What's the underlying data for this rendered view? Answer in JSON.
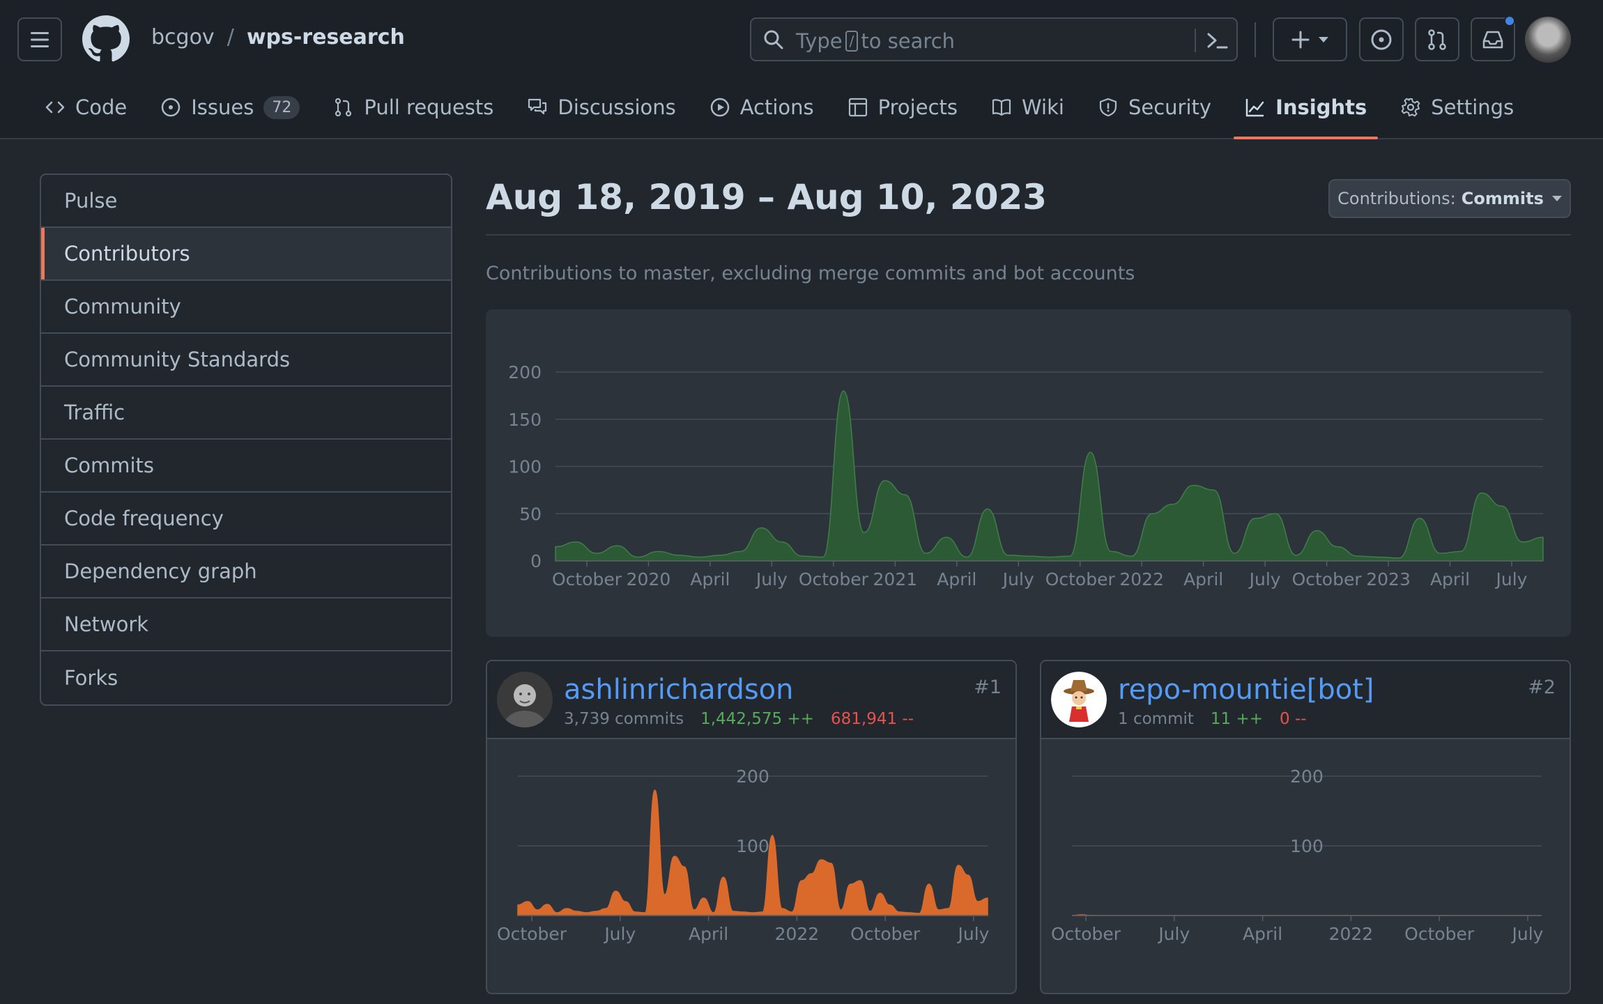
{
  "header": {
    "owner": "bcgov",
    "separator": "/",
    "repo": "wps-research",
    "search_placeholder_before": "Type",
    "search_kbd": "/",
    "search_placeholder_after": "to search"
  },
  "icons": [
    "menu-icon",
    "github-logo-icon",
    "search-icon",
    "command-palette-icon",
    "plus-icon",
    "chevron-down-icon",
    "issues-icon",
    "pull-request-icon",
    "inbox-icon"
  ],
  "nav": {
    "tabs": [
      {
        "label": "Code",
        "icon": "code-icon"
      },
      {
        "label": "Issues",
        "icon": "issue-opened-icon",
        "count": "72"
      },
      {
        "label": "Pull requests",
        "icon": "git-pull-request-icon"
      },
      {
        "label": "Discussions",
        "icon": "comment-discussion-icon"
      },
      {
        "label": "Actions",
        "icon": "play-icon"
      },
      {
        "label": "Projects",
        "icon": "table-icon"
      },
      {
        "label": "Wiki",
        "icon": "book-icon"
      },
      {
        "label": "Security",
        "icon": "shield-icon"
      },
      {
        "label": "Insights",
        "icon": "graph-icon",
        "active": true
      },
      {
        "label": "Settings",
        "icon": "gear-icon"
      }
    ]
  },
  "sidebar": {
    "items": [
      {
        "label": "Pulse"
      },
      {
        "label": "Contributors",
        "selected": true
      },
      {
        "label": "Community"
      },
      {
        "label": "Community Standards"
      },
      {
        "label": "Traffic"
      },
      {
        "label": "Commits"
      },
      {
        "label": "Code frequency"
      },
      {
        "label": "Dependency graph"
      },
      {
        "label": "Network"
      },
      {
        "label": "Forks"
      }
    ]
  },
  "main": {
    "date_range": "Aug 18, 2019 – Aug 10, 2023",
    "dropdown_prefix": "Contributions:",
    "dropdown_value": "Commits",
    "subtitle": "Contributions to master, excluding merge commits and bot accounts"
  },
  "colors": {
    "accent": "#ec775c",
    "main_area_fill": "#2b5a35",
    "main_area_stroke": "#3f7f49",
    "contributor_fill": "#d96a2b",
    "link": "#539bf5",
    "additions": "#57ab5a",
    "deletions": "#e5534b"
  },
  "chart_data": [
    {
      "type": "area",
      "ylim": [
        0,
        200
      ],
      "yticks": [
        "0",
        "50",
        "100",
        "150",
        "200"
      ],
      "grid": true,
      "xtick_labels": [
        "October",
        "2020",
        "April",
        "July",
        "October",
        "2021",
        "April",
        "July",
        "October",
        "2022",
        "April",
        "July",
        "October",
        "2023",
        "April",
        "July"
      ],
      "x": [
        "2019-08",
        "2019-09",
        "2019-10",
        "2019-11",
        "2019-12",
        "2020-01",
        "2020-02",
        "2020-03",
        "2020-04",
        "2020-05",
        "2020-06",
        "2020-07",
        "2020-08",
        "2020-09",
        "2020-10",
        "2020-11",
        "2020-12",
        "2021-01",
        "2021-02",
        "2021-03",
        "2021-04",
        "2021-05",
        "2021-06",
        "2021-07",
        "2021-08",
        "2021-09",
        "2021-10",
        "2021-11",
        "2021-12",
        "2022-01",
        "2022-02",
        "2022-03",
        "2022-04",
        "2022-05",
        "2022-06",
        "2022-07",
        "2022-08",
        "2022-09",
        "2022-10",
        "2022-11",
        "2022-12",
        "2023-01",
        "2023-02",
        "2023-03",
        "2023-04",
        "2023-05",
        "2023-06",
        "2023-07",
        "2023-08"
      ],
      "series": [
        {
          "values": [
            15,
            20,
            8,
            16,
            4,
            10,
            6,
            4,
            6,
            10,
            35,
            20,
            5,
            4,
            180,
            30,
            85,
            70,
            8,
            25,
            4,
            55,
            6,
            5,
            4,
            5,
            115,
            10,
            5,
            50,
            60,
            80,
            75,
            8,
            45,
            50,
            6,
            32,
            15,
            5,
            4,
            3,
            45,
            8,
            10,
            72,
            58,
            20,
            25
          ]
        }
      ]
    },
    {
      "type": "area",
      "name": "ashlinrichardson",
      "ylim": [
        0,
        200
      ],
      "yticks": [
        "100",
        "200"
      ],
      "grid": true,
      "xtick_labels": [
        "October",
        "July",
        "April",
        "2022",
        "October",
        "July"
      ],
      "series": [
        {
          "values": [
            15,
            20,
            8,
            16,
            4,
            10,
            6,
            4,
            6,
            10,
            35,
            20,
            5,
            4,
            180,
            30,
            85,
            70,
            8,
            25,
            4,
            55,
            6,
            5,
            4,
            5,
            115,
            10,
            5,
            50,
            60,
            80,
            75,
            8,
            45,
            50,
            6,
            32,
            15,
            5,
            4,
            3,
            45,
            8,
            10,
            72,
            58,
            20,
            25
          ]
        }
      ]
    },
    {
      "type": "area",
      "name": "repo-mountie[bot]",
      "ylim": [
        0,
        200
      ],
      "yticks": [
        "100",
        "200"
      ],
      "grid": true,
      "xtick_labels": [
        "October",
        "July",
        "April",
        "2022",
        "October",
        "July"
      ],
      "series": [
        {
          "values": [
            0,
            1,
            0,
            0,
            0,
            0,
            0,
            0,
            0,
            0,
            0,
            0,
            0,
            0,
            0,
            0,
            0,
            0,
            0,
            0,
            0,
            0,
            0,
            0,
            0,
            0,
            0,
            0,
            0,
            0,
            0,
            0,
            0,
            0,
            0,
            0,
            0,
            0,
            0,
            0,
            0,
            0,
            0,
            0,
            0,
            0,
            0,
            0,
            0
          ]
        }
      ]
    }
  ],
  "contributors": [
    {
      "name": "ashlinrichardson",
      "commits": "3,739 commits",
      "additions": "1,442,575 ++",
      "deletions": "681,941 --",
      "rank": "#1",
      "avatar_icon": "user-photo-avatar"
    },
    {
      "name": "repo-mountie[bot]",
      "commits": "1 commit",
      "additions": "11 ++",
      "deletions": "0 --",
      "rank": "#2",
      "avatar_icon": "mountie-bot-avatar"
    }
  ]
}
